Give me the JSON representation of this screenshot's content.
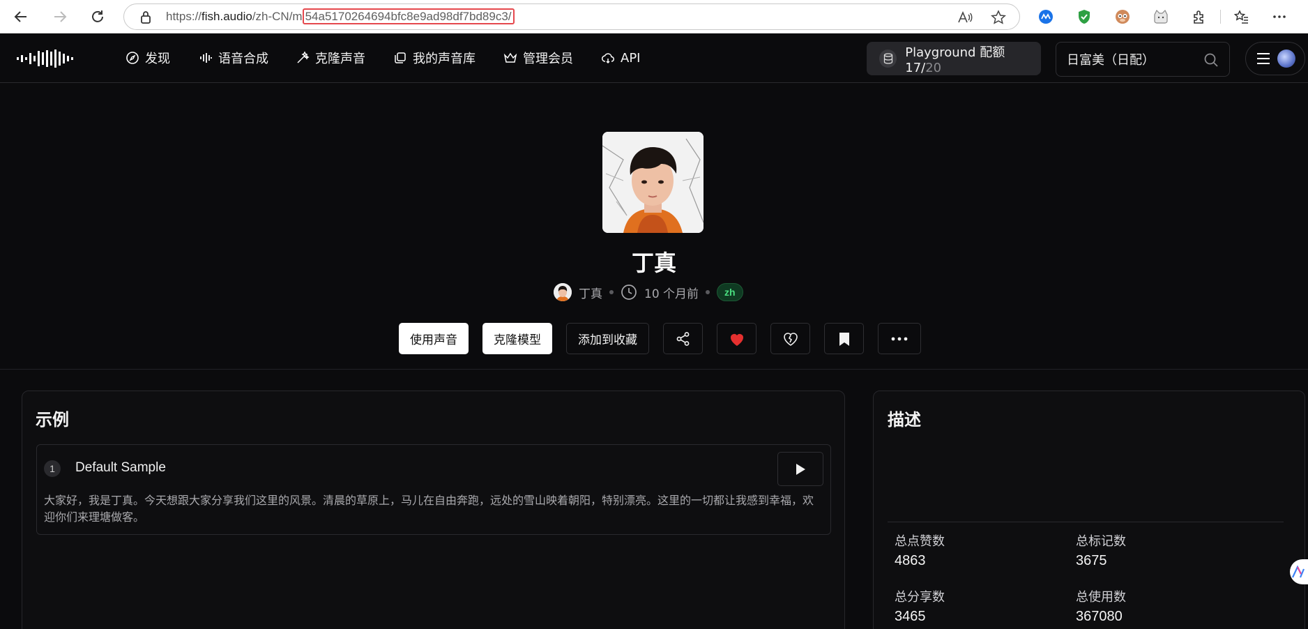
{
  "browser": {
    "url_prefix": "https://",
    "url_host": "fish.audio",
    "url_path": "/zh-CN/m",
    "url_highlight": "54a5170264694bfc8e9ad98df7bd89c3/"
  },
  "header": {
    "nav": [
      {
        "label": "发现",
        "icon": "compass-icon"
      },
      {
        "label": "语音合成",
        "icon": "waveform-icon"
      },
      {
        "label": "克隆声音",
        "icon": "magic-wand-icon"
      },
      {
        "label": "我的声音库",
        "icon": "library-icon"
      },
      {
        "label": "管理会员",
        "icon": "crown-icon"
      },
      {
        "label": "API",
        "icon": "cloud-icon"
      }
    ],
    "quota": {
      "label": "Playground 配额",
      "used": "17/",
      "total": "20"
    },
    "search": {
      "value": "日富美（日配）"
    }
  },
  "model": {
    "title": "丁真",
    "author": "丁真",
    "time": "10 个月前",
    "language": "zh"
  },
  "actions": {
    "use_voice": "使用声音",
    "clone_model": "克隆模型",
    "add_to_collection": "添加到收藏"
  },
  "samples": {
    "title": "示例",
    "items": [
      {
        "index": "1",
        "name": "Default Sample",
        "text": "大家好，我是丁真。今天想跟大家分享我们这里的风景。清晨的草原上，马儿在自由奔跑，远处的雪山映着朝阳，特别漂亮。这里的一切都让我感到幸福，欢迎你们来理塘做客。"
      }
    ]
  },
  "description": {
    "title": "描述",
    "stats": {
      "likes_label": "总点赞数",
      "likes_value": "4863",
      "marks_label": "总标记数",
      "marks_value": "3675",
      "shares_label": "总分享数",
      "shares_value": "3465",
      "uses_label": "总使用数",
      "uses_value": "367080"
    }
  },
  "colors": {
    "background": "#0b0b0d",
    "heart": "#e5302f",
    "badge_green": "#4ade80",
    "url_highlight": "#e5484d"
  }
}
